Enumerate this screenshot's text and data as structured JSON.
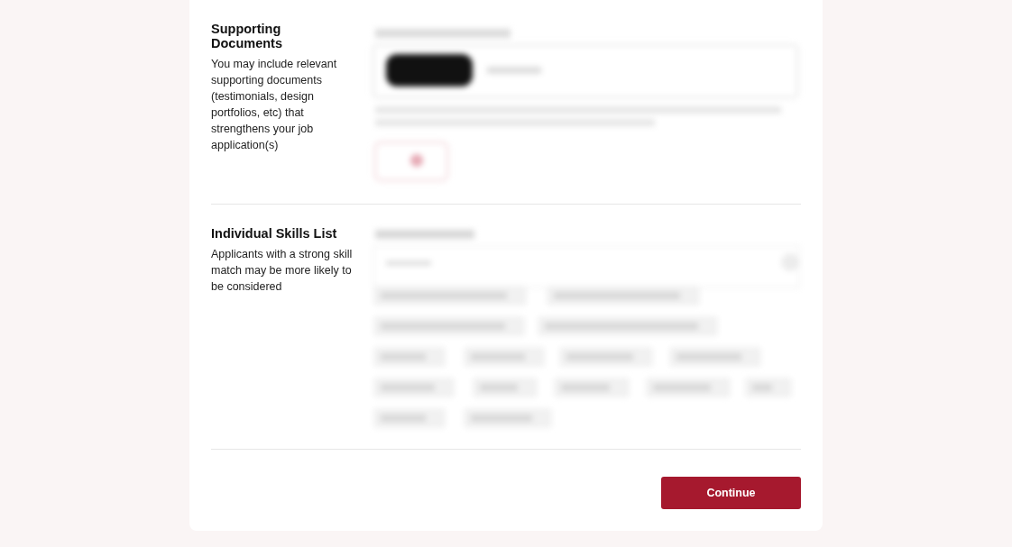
{
  "sections": [
    {
      "title": "Supporting Documents",
      "description": "You may include relevant supporting documents (testimonials, design portfolios, etc) that strengthens your job application(s)",
      "content": {
        "kind": "upload"
      }
    },
    {
      "title": "Individual Skills List",
      "description": "Applicants with a strong skill match may be more likely to be considered",
      "content": {
        "kind": "skills"
      }
    }
  ],
  "continue_button": {
    "label": "Continue"
  }
}
